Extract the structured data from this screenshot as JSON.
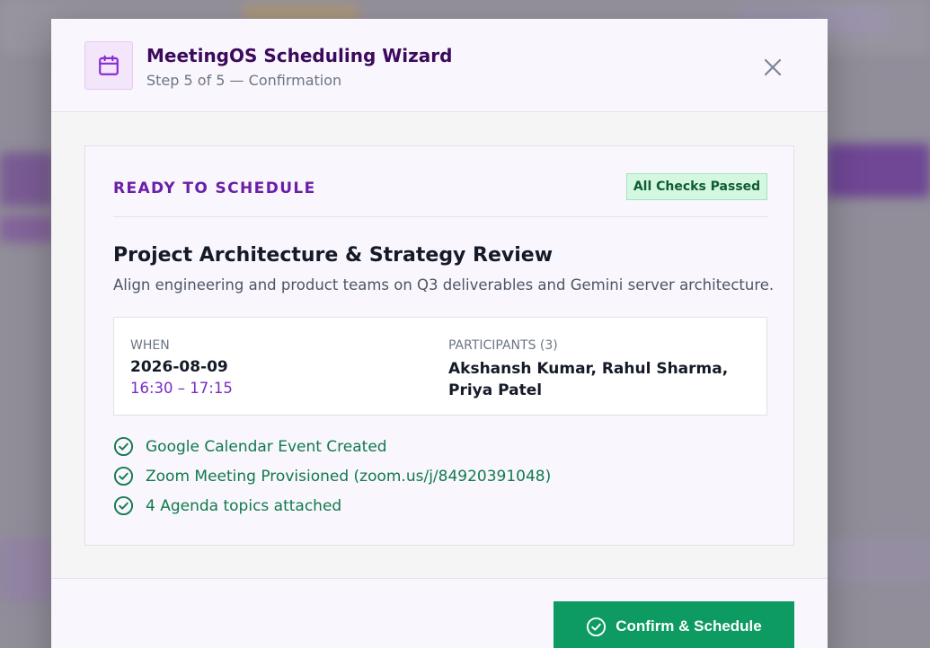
{
  "header": {
    "title": "MeetingOS Scheduling Wizard",
    "subtitle": "Step 5 of 5 — Confirmation",
    "icon": "calendar-icon",
    "close_icon": "close-icon"
  },
  "summary": {
    "status_label": "READY TO SCHEDULE",
    "badge": "All Checks Passed",
    "meeting_title": "Project Architecture & Strategy Review",
    "meeting_description": "Align engineering and product teams on Q3 deliverables and Gemini server architecture.",
    "when": {
      "label": "WHEN",
      "date": "2026-08-09",
      "time": "16:30 – 17:15"
    },
    "participants": {
      "label": "PARTICIPANTS (3)",
      "names": "Akshansh Kumar, Rahul Sharma, Priya Patel"
    },
    "checks": [
      {
        "label": "Google Calendar Event Created",
        "icon": "check-circle-icon"
      },
      {
        "label": "Zoom Meeting Provisioned (zoom.us/j/84920391048)",
        "icon": "check-circle-icon"
      },
      {
        "label": "4 Agenda topics attached",
        "icon": "check-circle-icon"
      }
    ]
  },
  "footer": {
    "confirm_label": "Confirm & Schedule",
    "confirm_icon": "check-circle-icon"
  },
  "colors": {
    "accent": "#6b1fa6",
    "title": "#3b0a5c",
    "success": "#107a4b",
    "button": "#0e9b62"
  }
}
